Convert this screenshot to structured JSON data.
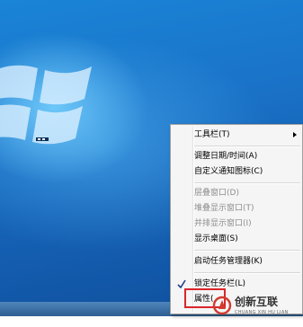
{
  "menu": {
    "items": [
      {
        "label": "工具栏(T)",
        "has_submenu": true,
        "disabled": false
      },
      {
        "label": "调整日期/时间(A)",
        "disabled": false
      },
      {
        "label": "自定义通知图标(C)",
        "disabled": false
      },
      {
        "label": "层叠窗口(D)",
        "disabled": true
      },
      {
        "label": "堆叠显示窗口(T)",
        "disabled": true
      },
      {
        "label": "并排显示窗口(I)",
        "disabled": true
      },
      {
        "label": "显示桌面(S)",
        "disabled": false
      },
      {
        "label": "启动任务管理器(K)",
        "disabled": false
      },
      {
        "label": "锁定任务栏(L)",
        "checked": true,
        "disabled": false
      },
      {
        "label": "属性(",
        "disabled": false
      }
    ]
  },
  "watermark": {
    "name": "创新互联",
    "sub": "CHUANG XIN HU LIAN"
  },
  "colors": {
    "desktop": "#1a73c8",
    "highlight_border": "#d9262b",
    "menu_bg": "#f5f5f5"
  }
}
